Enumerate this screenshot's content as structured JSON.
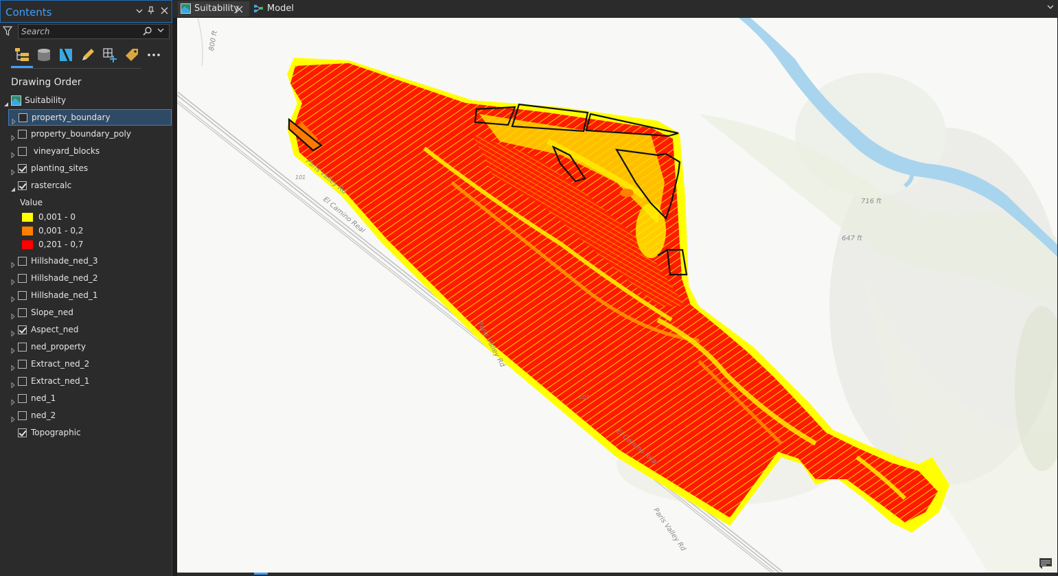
{
  "contents_pane": {
    "title": "Contents",
    "header_icons": [
      "chevron-down-icon",
      "pin-icon",
      "close-icon"
    ],
    "search": {
      "placeholder": "Search",
      "value": ""
    },
    "toolbar_icons": [
      "list-by-drawing-order-icon",
      "list-by-data-source-icon",
      "list-by-selection-icon",
      "list-by-editing-icon",
      "list-by-snapping-icon",
      "list-by-labeling-icon",
      "more-icon"
    ],
    "drawing_order_label": "Drawing Order",
    "map_name": "Suitability",
    "layers": [
      {
        "name": "property_boundary",
        "checked": false,
        "selected": true,
        "expanded": false
      },
      {
        "name": "property_boundary_poly",
        "checked": false,
        "selected": false,
        "expanded": false
      },
      {
        "name": " vineyard_blocks",
        "checked": false,
        "selected": false,
        "expanded": false
      },
      {
        "name": "planting_sites",
        "checked": true,
        "selected": false,
        "expanded": false
      },
      {
        "name": "rastercalc",
        "checked": true,
        "selected": false,
        "expanded": true
      },
      {
        "name": "Hillshade_ned_3",
        "checked": false,
        "selected": false,
        "expanded": false
      },
      {
        "name": "Hillshade_ned_2",
        "checked": false,
        "selected": false,
        "expanded": false
      },
      {
        "name": "Hillshade_ned_1",
        "checked": false,
        "selected": false,
        "expanded": false
      },
      {
        "name": "Slope_ned",
        "checked": false,
        "selected": false,
        "expanded": false
      },
      {
        "name": "Aspect_ned",
        "checked": true,
        "selected": false,
        "expanded": false
      },
      {
        "name": "ned_property",
        "checked": false,
        "selected": false,
        "expanded": false
      },
      {
        "name": "Extract_ned_2",
        "checked": false,
        "selected": false,
        "expanded": false
      },
      {
        "name": "Extract_ned_1",
        "checked": false,
        "selected": false,
        "expanded": false
      },
      {
        "name": "ned_1",
        "checked": false,
        "selected": false,
        "expanded": false
      },
      {
        "name": "ned_2",
        "checked": false,
        "selected": false,
        "expanded": false
      },
      {
        "name": "Topographic",
        "checked": true,
        "selected": false,
        "expanded": null
      }
    ],
    "legend": {
      "title": "Value",
      "items": [
        {
          "label": "0,001 - 0",
          "color": "#ffff00"
        },
        {
          "label": "0,001 - 0,2",
          "color": "#ff8000"
        },
        {
          "label": "0,201 - 0,7",
          "color": "#ff0000"
        }
      ]
    }
  },
  "tabs": [
    {
      "label": "Suitability",
      "active": true,
      "icon": "map-icon"
    },
    {
      "label": "Model",
      "active": false,
      "icon": "model-icon"
    }
  ],
  "map": {
    "labels": [
      {
        "text": "Paris Valley Rd"
      },
      {
        "text": "101"
      },
      {
        "text": "El Camino Real"
      },
      {
        "text": "Paris Valley Rd"
      },
      {
        "text": "101"
      },
      {
        "text": "El Camino Real"
      },
      {
        "text": "Paris Valley Rd"
      },
      {
        "text": "716 ft"
      },
      {
        "text": "647 ft"
      },
      {
        "text": "800 ft"
      }
    ],
    "colors": {
      "high": "#ff0000",
      "mid": "#ff8000",
      "low": "#ffff00",
      "river": "#a8d4ee",
      "basemap": "#f8f8f6"
    }
  }
}
